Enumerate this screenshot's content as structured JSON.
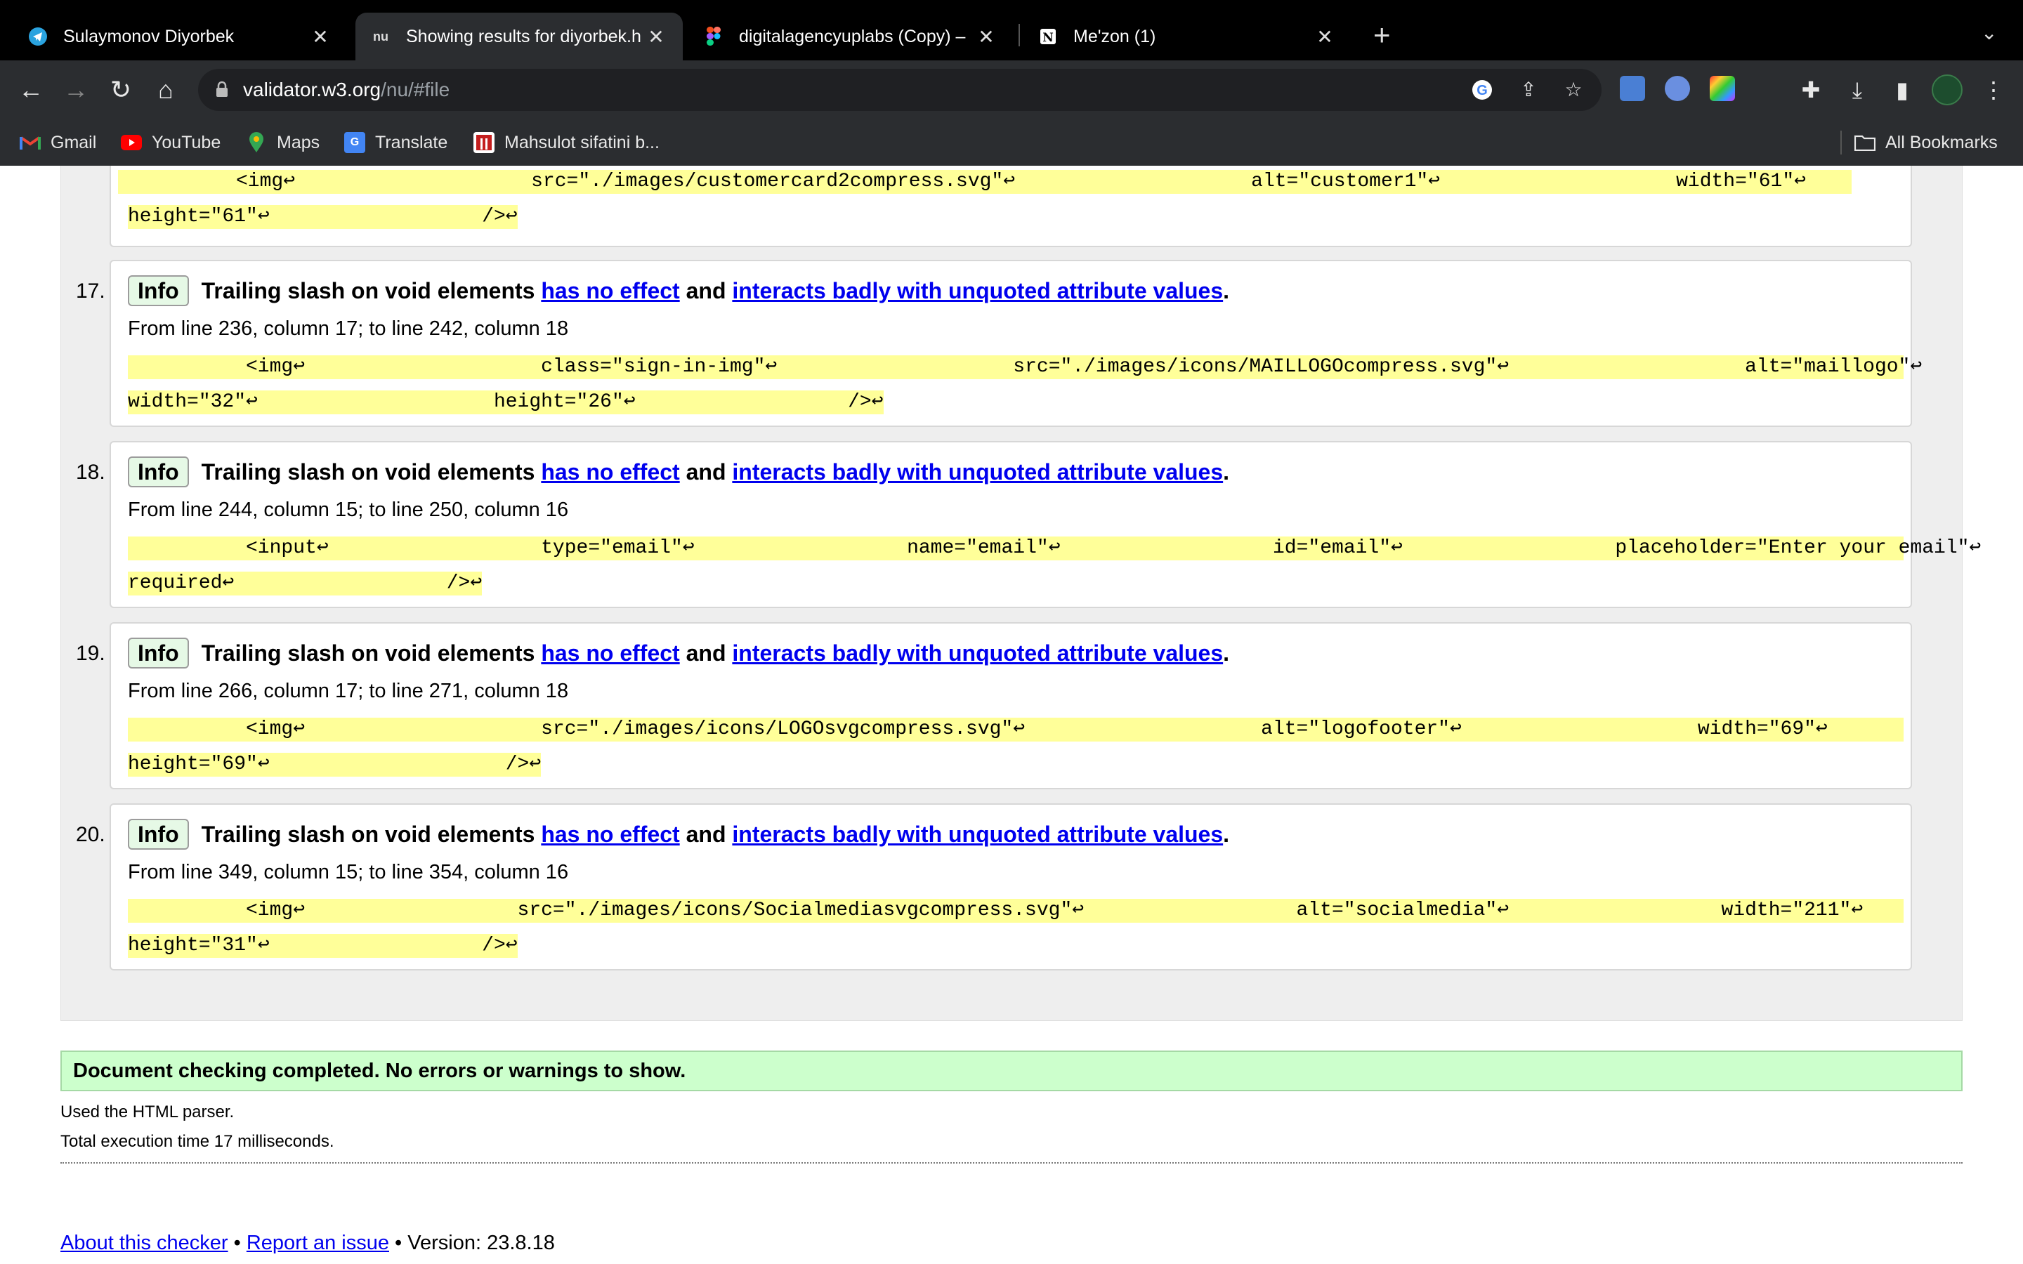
{
  "browser": {
    "tabs": [
      {
        "title": "Sulaymonov Diyorbek",
        "icon": "telegram-icon",
        "active": false
      },
      {
        "title": "Showing results for diyorbek.h",
        "icon": "nu-icon",
        "active": true
      },
      {
        "title": "digitalagencyuplabs (Copy) –",
        "icon": "figma-icon",
        "active": false
      },
      {
        "title": "Me'zon (1)",
        "icon": "notion-icon",
        "active": false
      }
    ],
    "tab_close": "✕",
    "new_tab": "+",
    "url_host": "validator.w3.org",
    "url_path": "/nu/#file",
    "bookmarks": [
      {
        "label": "Gmail",
        "icon": "gmail-icon"
      },
      {
        "label": "YouTube",
        "icon": "youtube-icon"
      },
      {
        "label": "Maps",
        "icon": "maps-icon"
      },
      {
        "label": "Translate",
        "icon": "translate-icon"
      },
      {
        "label": "Mahsulot sifatini b...",
        "icon": "bookmark-site-icon"
      }
    ],
    "all_bookmarks": "All Bookmarks"
  },
  "top_partial": {
    "line1": "<img↩                    src=\"./images/customercard2compress.svg\"↩                    alt=\"customer1\"↩                    width=\"61\"↩                    ",
    "line2": "height=\"61\"↩                  />↩"
  },
  "messages": [
    {
      "number": "17.",
      "badge": "Info",
      "text_before": "Trailing slash on void elements",
      "link1": "has no effect",
      "text_middle": "and",
      "link2": "interacts badly with unquoted attribute values",
      "text_after": ".",
      "location": "From line 236, column 17; to line 242, column 18",
      "code_line1": "<img↩                    class=\"sign-in-img\"↩                    src=\"./images/icons/MAILLOGOcompress.svg\"↩                    alt=\"maillogo\"↩      ",
      "code_line2": "width=\"32\"↩                    height=\"26\"↩                  />↩"
    },
    {
      "number": "18.",
      "badge": "Info",
      "text_before": "Trailing slash on void elements",
      "link1": "has no effect",
      "text_middle": "and",
      "link2": "interacts badly with unquoted attribute values",
      "text_after": ".",
      "location": "From line 244, column 15; to line 250, column 16",
      "code_line1": "<input↩                  type=\"email\"↩                  name=\"email\"↩                  id=\"email\"↩                  placeholder=\"Enter your email\"↩  ",
      "code_line2": "required↩                  />↩"
    },
    {
      "number": "19.",
      "badge": "Info",
      "text_before": "Trailing slash on void elements",
      "link1": "has no effect",
      "text_middle": "and",
      "link2": "interacts badly with unquoted attribute values",
      "text_after": ".",
      "location": "From line 266, column 17; to line 271, column 18",
      "code_line1": "<img↩                    src=\"./images/icons/LOGOsvgcompress.svg\"↩                    alt=\"logofooter\"↩                    width=\"69\"↩                ",
      "code_line2": "height=\"69\"↩                    />↩"
    },
    {
      "number": "20.",
      "badge": "Info",
      "text_before": "Trailing slash on void elements",
      "link1": "has no effect",
      "text_middle": "and",
      "link2": "interacts badly with unquoted attribute values",
      "text_after": ".",
      "location": "From line 349, column 15; to line 354, column 16",
      "code_line1": "<img↩                  src=\"./images/icons/Socialmediasvgcompress.svg\"↩                  alt=\"socialmedia\"↩                  width=\"211\"↩        ",
      "code_line2": "height=\"31\"↩                  />↩"
    }
  ],
  "success": "Document checking completed. No errors or warnings to show.",
  "parser_note": "Used the HTML parser.",
  "execution_time": "Total execution time 17 milliseconds.",
  "footer": {
    "about": "About this checker",
    "sep1": " • ",
    "report": "Report an issue",
    "sep2": " • ",
    "version": "Version: 23.8.18"
  },
  "colors": {
    "code_highlight": "#ffff99",
    "success_bg": "#ccffcc",
    "info_badge_bg": "#e6f9e6",
    "link": "#0000ee"
  }
}
